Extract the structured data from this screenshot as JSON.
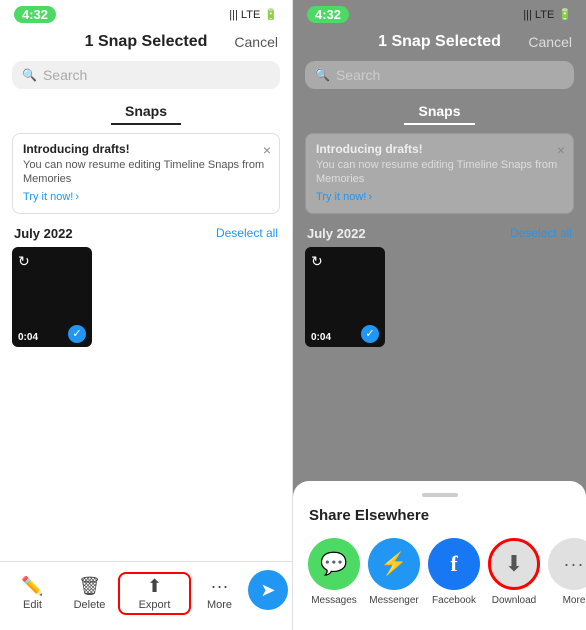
{
  "left": {
    "statusBar": {
      "time": "4:32",
      "signal": "|||  LTE",
      "battery": "🔋"
    },
    "header": {
      "title": "1 Snap Selected",
      "cancelLabel": "Cancel"
    },
    "search": {
      "placeholder": "Search"
    },
    "tabs": [
      {
        "label": "Snaps",
        "active": true
      }
    ],
    "notice": {
      "title": "Introducing drafts!",
      "body": "You can now resume editing Timeline Snaps from Memories",
      "linkText": "Try it now!",
      "closeSymbol": "×"
    },
    "section": {
      "title": "July 2022",
      "deselectLabel": "Deselect all"
    },
    "snap": {
      "duration": "0:04",
      "refreshSymbol": "↻"
    },
    "toolbar": {
      "editLabel": "Edit",
      "deleteLabel": "Delete",
      "exportLabel": "Export",
      "moreLabel": "More",
      "editIcon": "✏️",
      "deleteIcon": "🗑",
      "exportIcon": "⬆",
      "moreIcon": "···"
    }
  },
  "right": {
    "statusBar": {
      "time": "4:32",
      "signal": "|||  LTE",
      "battery": "🔋"
    },
    "header": {
      "title": "1 Snap Selected",
      "cancelLabel": "Cancel"
    },
    "search": {
      "placeholder": "Search"
    },
    "tabs": [
      {
        "label": "Snaps",
        "active": true
      }
    ],
    "notice": {
      "title": "Introducing drafts!",
      "body": "You can now resume editing Timeline Snaps from Memories",
      "linkText": "Try it now!",
      "closeSymbol": "×"
    },
    "section": {
      "title": "July 2022",
      "deselectLabel": "Deselect all"
    },
    "snap": {
      "duration": "0:04",
      "refreshSymbol": "↻"
    },
    "shareSheet": {
      "title": "Share Elsewhere",
      "items": [
        {
          "id": "messages",
          "label": "Messages",
          "colorClass": "messages",
          "icon": "💬"
        },
        {
          "id": "messenger",
          "label": "Messenger",
          "colorClass": "messenger",
          "icon": "⚡"
        },
        {
          "id": "facebook",
          "label": "Facebook",
          "colorClass": "facebook",
          "icon": "f"
        },
        {
          "id": "download",
          "label": "Download",
          "colorClass": "download",
          "icon": "⬇"
        },
        {
          "id": "more",
          "label": "More",
          "colorClass": "more",
          "icon": "···"
        }
      ]
    }
  }
}
